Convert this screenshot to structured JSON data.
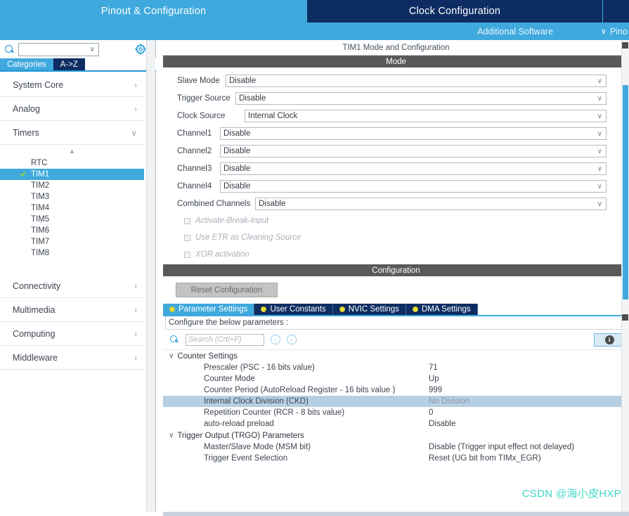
{
  "topbar": {
    "tabs": [
      {
        "label": "Pinout & Configuration",
        "active": false
      },
      {
        "label": "Clock Configuration",
        "active": true
      }
    ],
    "additional_software": "Additional Software",
    "pinout_menu": "Pino",
    "chevron": "∨"
  },
  "sidebar": {
    "search_placeholder": "",
    "search_icon": "search-icon",
    "gear_icon": "gear-icon",
    "tabs": [
      {
        "label": "Categories",
        "active": true
      },
      {
        "label": "A->Z",
        "active": false
      }
    ],
    "categories": [
      {
        "label": "System Core",
        "arrow": "›",
        "expanded": false
      },
      {
        "label": "Analog",
        "arrow": "›",
        "expanded": false
      },
      {
        "label": "Timers",
        "arrow": "∨",
        "expanded": true
      }
    ],
    "timers": [
      {
        "label": "RTC",
        "selected": false
      },
      {
        "label": "TIM1",
        "selected": true,
        "check": "✔"
      },
      {
        "label": "TIM2",
        "selected": false
      },
      {
        "label": "TIM3",
        "selected": false
      },
      {
        "label": "TIM4",
        "selected": false
      },
      {
        "label": "TIM5",
        "selected": false
      },
      {
        "label": "TIM6",
        "selected": false
      },
      {
        "label": "TIM7",
        "selected": false
      },
      {
        "label": "TIM8",
        "selected": false
      }
    ],
    "categories_bottom": [
      {
        "label": "Connectivity",
        "arrow": "›"
      },
      {
        "label": "Multimedia",
        "arrow": "›"
      },
      {
        "label": "Computing",
        "arrow": "›"
      },
      {
        "label": "Middleware",
        "arrow": "›"
      }
    ]
  },
  "panel": {
    "title": "TIM1 Mode and Configuration",
    "mode_band": "Mode",
    "configuration_band": "Configuration"
  },
  "mode": {
    "rows": [
      {
        "label": "Slave Mode",
        "value": "Disable",
        "label_w": 66
      },
      {
        "label": "Trigger Source",
        "value": "Disable",
        "label_w": 80
      },
      {
        "label": "Clock Source",
        "value": "Internal Clock",
        "label_w": 93
      },
      {
        "label": "Channel1",
        "value": "Disable",
        "label_w": 58
      },
      {
        "label": "Channel2",
        "value": "Disable",
        "label_w": 58
      },
      {
        "label": "Channel3",
        "value": "Disable",
        "label_w": 58
      },
      {
        "label": "Channel4",
        "value": "Disable",
        "label_w": 58
      },
      {
        "label": "Combined Channels",
        "value": "Disable",
        "label_w": 108
      }
    ],
    "checkboxes": [
      {
        "label": "Activate-Break-Input",
        "checked": false,
        "disabled": true
      },
      {
        "label": "Use ETR as Cleaning Source",
        "checked": false,
        "disabled": true
      },
      {
        "label": "XOR activation",
        "checked": false,
        "disabled": true
      }
    ],
    "chevron": "∨"
  },
  "configuration": {
    "reset_button": "Reset Configuration",
    "tabs": [
      {
        "label": "Parameter Settings",
        "active": true
      },
      {
        "label": "User Constants",
        "active": false
      },
      {
        "label": "NVIC Settings",
        "active": false
      },
      {
        "label": "DMA Settings",
        "active": false
      }
    ],
    "note": "Configure the below parameters :",
    "search_placeholder": "Search (Crtl+F)",
    "nav_prev_icon": "‹",
    "nav_next_icon": "›",
    "info_icon": "i"
  },
  "parameters": {
    "groups": [
      {
        "name": "Counter Settings",
        "caret": "∨",
        "rows": [
          {
            "name": "Prescaler (PSC - 16 bits value)",
            "value": "71",
            "highlighted": false
          },
          {
            "name": "Counter Mode",
            "value": "Up",
            "highlighted": false
          },
          {
            "name": "Counter Period (AutoReload Register - 16 bits value )",
            "value": "999",
            "highlighted": false
          },
          {
            "name": "Internal Clock Division (CKD)",
            "value": "No Division",
            "highlighted": true
          },
          {
            "name": "Repetition Counter (RCR - 8 bits value)",
            "value": "0",
            "highlighted": false
          },
          {
            "name": "auto-reload preload",
            "value": "Disable",
            "highlighted": false
          }
        ]
      },
      {
        "name": "Trigger Output (TRGO) Parameters",
        "caret": "∨",
        "rows": [
          {
            "name": "Master/Slave Mode (MSM bit)",
            "value": "Disable (Trigger input effect not delayed)",
            "highlighted": false
          },
          {
            "name": "Trigger Event Selection",
            "value": "Reset (UG bit from TIMx_EGR)",
            "highlighted": false
          }
        ]
      }
    ]
  },
  "watermark": "CSDN @海小皮HXP",
  "colors": {
    "accent_blue": "#3fa9dd",
    "dark_navy": "#0d2d62",
    "band_gray": "#595959",
    "highlight_row": "#b6cfe3",
    "watermark": "#41d6c8",
    "check_green": "#8fd14f",
    "tab_dot": "#e8e03a"
  }
}
